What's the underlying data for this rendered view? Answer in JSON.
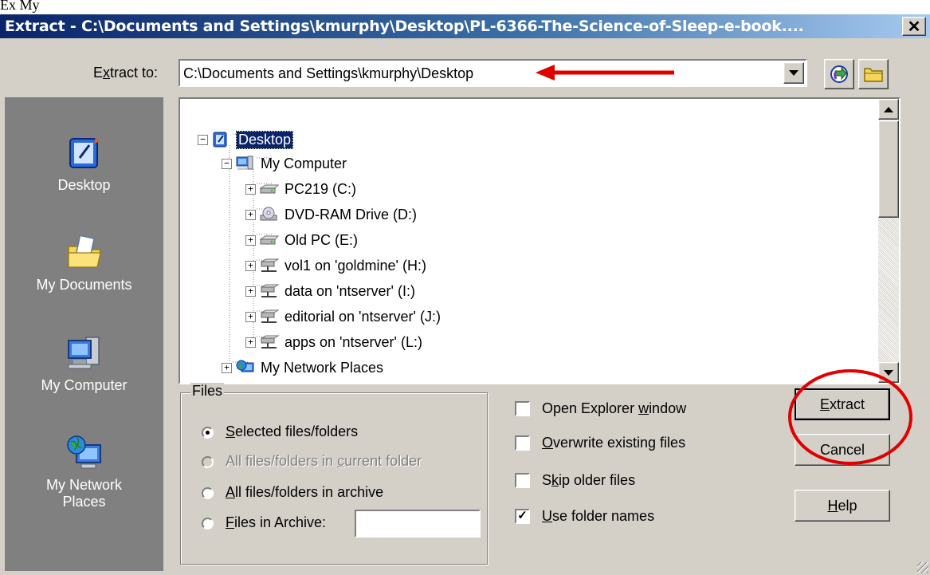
{
  "doc_fragment": "Ex     My",
  "window": {
    "title": "Extract - C:\\Documents and Settings\\kmurphy\\Desktop\\PL-6366-The-Science-of-Sleep-e-book....",
    "close_label": "✕"
  },
  "extract_to": {
    "label_pre": "E",
    "label_acc": "x",
    "label_post": "tract to:",
    "value": "C:\\Documents and Settings\\kmurphy\\Desktop"
  },
  "places": [
    {
      "label": "Desktop",
      "icon": "desktop-icon"
    },
    {
      "label": "My Documents",
      "icon": "my-documents-icon"
    },
    {
      "label": "My Computer",
      "icon": "my-computer-icon"
    },
    {
      "label": "My Network Places",
      "label_line1": "My Network",
      "label_line2": "Places",
      "icon": "network-places-icon"
    }
  ],
  "tree": {
    "items": [
      {
        "label": "Desktop",
        "expander": "−",
        "icon": "desktop-icon",
        "selected": true
      },
      {
        "label": "My Computer",
        "expander": "−",
        "icon": "my-computer-icon"
      },
      {
        "label": "PC219 (C:)",
        "expander": "+",
        "icon": "drive-icon"
      },
      {
        "label": "DVD-RAM Drive (D:)",
        "expander": "+",
        "icon": "dvd-drive-icon"
      },
      {
        "label": "Old PC (E:)",
        "expander": "+",
        "icon": "drive-icon"
      },
      {
        "label": "vol1 on 'goldmine' (H:)",
        "expander": "+",
        "icon": "network-drive-icon"
      },
      {
        "label": "data on 'ntserver' (I:)",
        "expander": "+",
        "icon": "network-drive-icon"
      },
      {
        "label": "editorial on 'ntserver' (J:)",
        "expander": "+",
        "icon": "network-drive-icon"
      },
      {
        "label": "apps on 'ntserver' (L:)",
        "expander": "+",
        "icon": "network-drive-icon"
      },
      {
        "label": "My Network Places",
        "expander": "+",
        "icon": "network-places-icon"
      }
    ]
  },
  "files_group": {
    "title": "Files",
    "options": [
      {
        "pre": "",
        "acc": "S",
        "post": "elected files/folders",
        "selected": true,
        "enabled": true
      },
      {
        "pre": "All files/folders in ",
        "acc": "c",
        "post": "urrent folder",
        "selected": false,
        "enabled": false
      },
      {
        "pre": "",
        "acc": "A",
        "post": "ll files/folders in archive",
        "selected": false,
        "enabled": true
      },
      {
        "pre": "",
        "acc": "F",
        "post": "iles in Archive:",
        "selected": false,
        "enabled": true
      }
    ],
    "files_in_archive_value": ""
  },
  "checkboxes": [
    {
      "pre": "Open Explorer ",
      "acc": "w",
      "post": "indow",
      "checked": false
    },
    {
      "pre": "",
      "acc": "O",
      "post": "verwrite existing files",
      "checked": false
    },
    {
      "pre": "S",
      "acc": "k",
      "post": "ip older files",
      "checked": false
    },
    {
      "pre": "",
      "acc": "U",
      "post": "se folder names",
      "checked": true
    }
  ],
  "buttons": {
    "extract": {
      "acc": "E",
      "post": "xtract"
    },
    "cancel": {
      "label": "Cancel"
    },
    "help": {
      "acc": "H",
      "post": "elp"
    }
  },
  "annotations": {
    "arrow_color": "#e00000",
    "circle_color": "#e00000"
  },
  "colors": {
    "title_start": "#0a246a",
    "title_end": "#a6caf0",
    "face": "#d4d0c8",
    "places_bg": "#808080",
    "selection": "#0a246a"
  }
}
